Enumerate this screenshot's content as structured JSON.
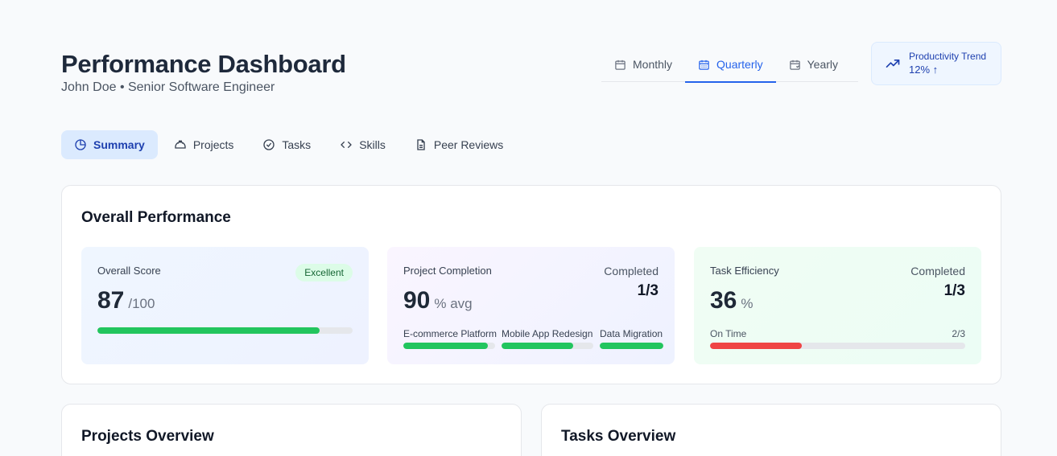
{
  "header": {
    "title": "Performance Dashboard",
    "subtitle": "John Doe • Senior Software Engineer"
  },
  "period_tabs": [
    {
      "label": "Monthly",
      "icon": "calendar-icon",
      "active": false
    },
    {
      "label": "Quarterly",
      "icon": "calendar-grid-icon",
      "active": true
    },
    {
      "label": "Yearly",
      "icon": "calendar-range-icon",
      "active": false
    }
  ],
  "trend": {
    "label": "Productivity Trend",
    "value": "12% ↑",
    "icon": "trending-up-icon"
  },
  "nav": [
    {
      "label": "Summary",
      "icon": "pie-chart-icon",
      "active": true
    },
    {
      "label": "Projects",
      "icon": "hard-hat-icon",
      "active": false
    },
    {
      "label": "Tasks",
      "icon": "check-circle-icon",
      "active": false
    },
    {
      "label": "Skills",
      "icon": "code-icon",
      "active": false
    },
    {
      "label": "Peer Reviews",
      "icon": "file-text-icon",
      "active": false
    }
  ],
  "overall": {
    "title": "Overall Performance",
    "score": {
      "label": "Overall Score",
      "badge": "Excellent",
      "value": "87",
      "unit": "/100",
      "progress": 0.87
    },
    "project_completion": {
      "label": "Project Completion",
      "value": "90",
      "unit": "% avg",
      "completed_label": "Completed",
      "completed_value": "1/3",
      "projects": [
        {
          "name": "E-commerce Platform",
          "progress": 0.92
        },
        {
          "name": "Mobile App Redesign",
          "progress": 0.78
        },
        {
          "name": "Data Migration",
          "progress": 1.0
        }
      ]
    },
    "task_efficiency": {
      "label": "Task Efficiency",
      "value": "36",
      "unit": "%",
      "completed_label": "Completed",
      "completed_value": "1/3",
      "ontime_label": "On Time",
      "ontime_value": "2/3",
      "progress": 0.36
    }
  },
  "sections": {
    "projects_title": "Projects Overview",
    "tasks_title": "Tasks Overview"
  },
  "colors": {
    "accent": "#2563eb",
    "success": "#22c55e",
    "danger": "#ef4444"
  }
}
